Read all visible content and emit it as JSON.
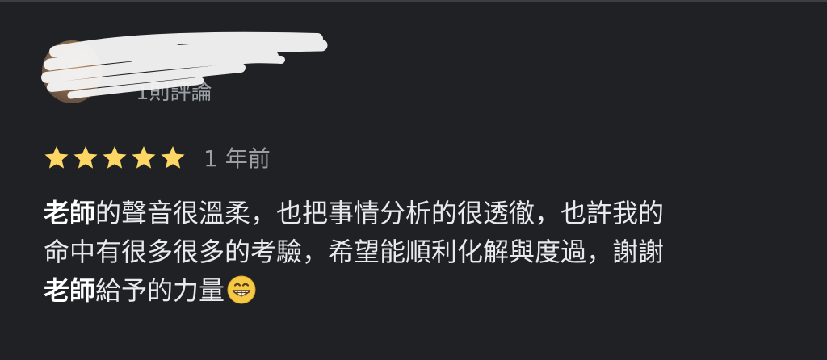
{
  "reviewer": {
    "name": "",
    "review_count": "1則評論"
  },
  "review": {
    "rating": 5,
    "rating_max": 5,
    "date": "1 年前",
    "line1_bold": "老師",
    "line1_rest": "的聲音很溫柔，也把事情分析的很透徹，也許我的",
    "line2": "命中有很多很多的考驗，希望能順利化解與度過，謝謝",
    "line3_bold": "老師",
    "line3_rest": "給予的力量",
    "emoji": "grinning-face-icon"
  },
  "colors": {
    "background": "#202124",
    "star": "#fdd663",
    "text": "#e8eaed",
    "secondary_text": "#9aa0a6"
  }
}
